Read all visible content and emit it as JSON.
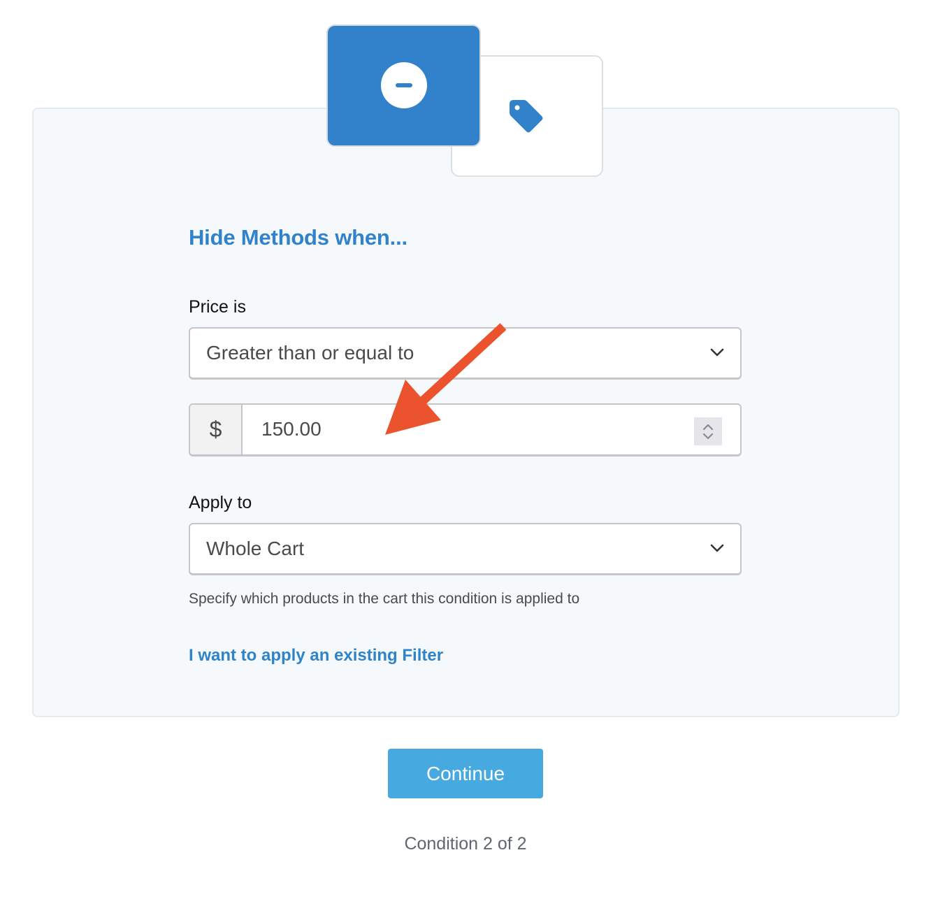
{
  "header": {
    "cards": [
      {
        "icon": "minus-circle-icon",
        "state": "active",
        "color": "#3182ca"
      },
      {
        "icon": "tag-icon",
        "state": "inactive",
        "color": "#3182ca"
      }
    ]
  },
  "form": {
    "title": "Hide Methods when...",
    "price": {
      "label": "Price is",
      "operator": "Greater than or equal to",
      "currency_symbol": "$",
      "amount": "150.00"
    },
    "apply_to": {
      "label": "Apply to",
      "value": "Whole Cart",
      "help_text": "Specify which products in the cart this condition is applied to"
    },
    "filter_link": "I want to apply an existing Filter"
  },
  "footer": {
    "continue_label": "Continue",
    "progress_text": "Condition 2 of 2"
  },
  "annotation": {
    "type": "arrow",
    "color": "#ea532d",
    "points_to": "price-amount-input"
  },
  "colors": {
    "accent": "#3182ca",
    "button": "#46a9df",
    "panel_bg": "#f6f9fc"
  }
}
